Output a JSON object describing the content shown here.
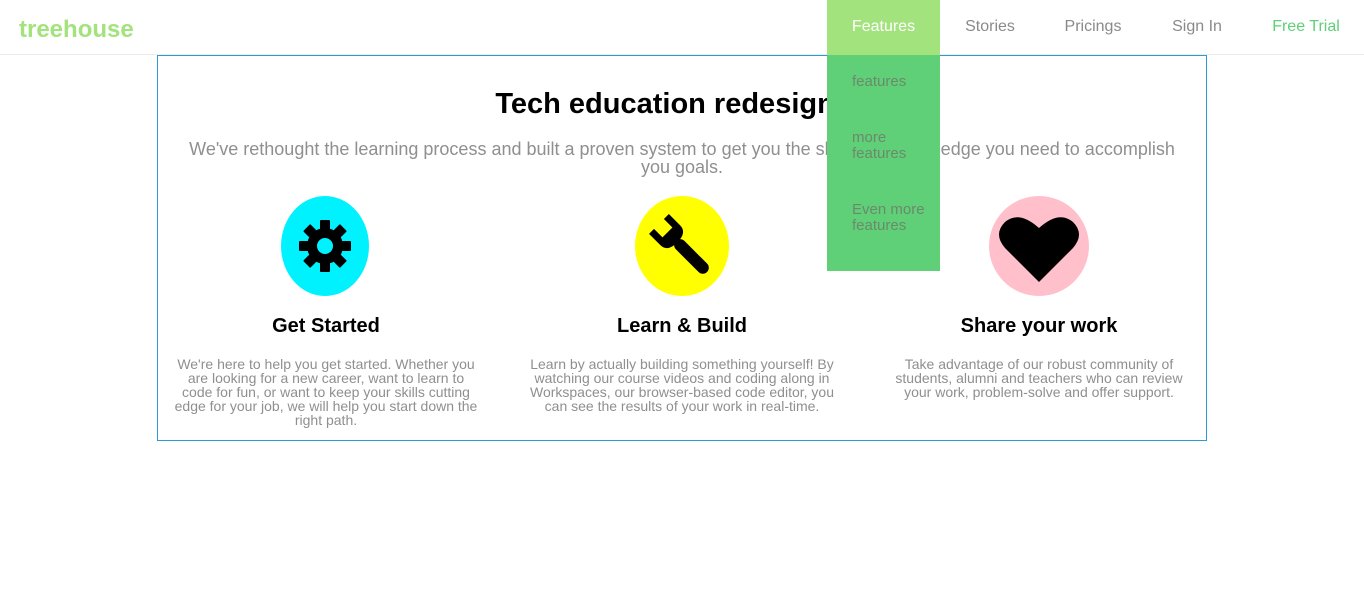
{
  "header": {
    "logo": "treehouse",
    "nav": [
      {
        "label": "Features",
        "active": true
      },
      {
        "label": "Stories"
      },
      {
        "label": "Pricings"
      },
      {
        "label": "Sign In"
      },
      {
        "label": "Free Trial"
      }
    ]
  },
  "dropdown": {
    "items": [
      "features",
      "more features",
      "Even more features"
    ]
  },
  "main": {
    "title": "Tech education redesigned",
    "subtitle": "We've rethought the learning process and built a proven system to get you the skills and knowledge you need to accomplish you goals.",
    "features": [
      {
        "icon": "gear-icon",
        "color": "#00f2ff",
        "title": "Get Started",
        "text": "We're here to help you get started. Whether you are looking for a new career, want to learn to code for fun, or want to keep your skills cutting edge for your job, we will help you start down the right path."
      },
      {
        "icon": "wrench-icon",
        "color": "#ffff00",
        "title": "Learn & Build",
        "text": "Learn by actually building something yourself! By watching our course videos and coding along in Workspaces, our browser-based code editor, you can see the results of your work in real-time."
      },
      {
        "icon": "heart-icon",
        "color": "#ffc0cb",
        "title": "Share your work",
        "text": "Take advantage of our robust community of students, alumni and teachers who can review your work, problem-solve and offer support."
      }
    ]
  },
  "colors": {
    "brand": "#a3e37d",
    "dropdown": "#5fcf78",
    "border": "#2b9bd8"
  }
}
